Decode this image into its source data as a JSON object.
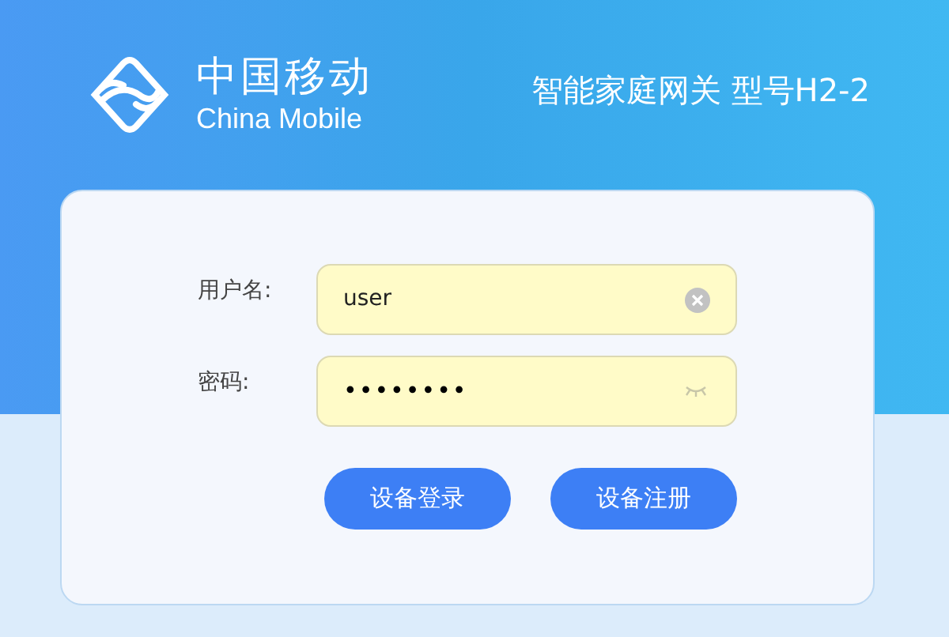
{
  "brand": {
    "name_zh": "中国移动",
    "name_en": "China Mobile"
  },
  "header": {
    "title": "智能家庭网关 型号H2-2"
  },
  "fields": [
    {
      "label": "用户名:",
      "value": "user",
      "kind": "text"
    },
    {
      "label": "密码:",
      "value": "••••••••",
      "kind": "password"
    }
  ],
  "buttons": [
    "设备登录",
    "设备注册"
  ]
}
